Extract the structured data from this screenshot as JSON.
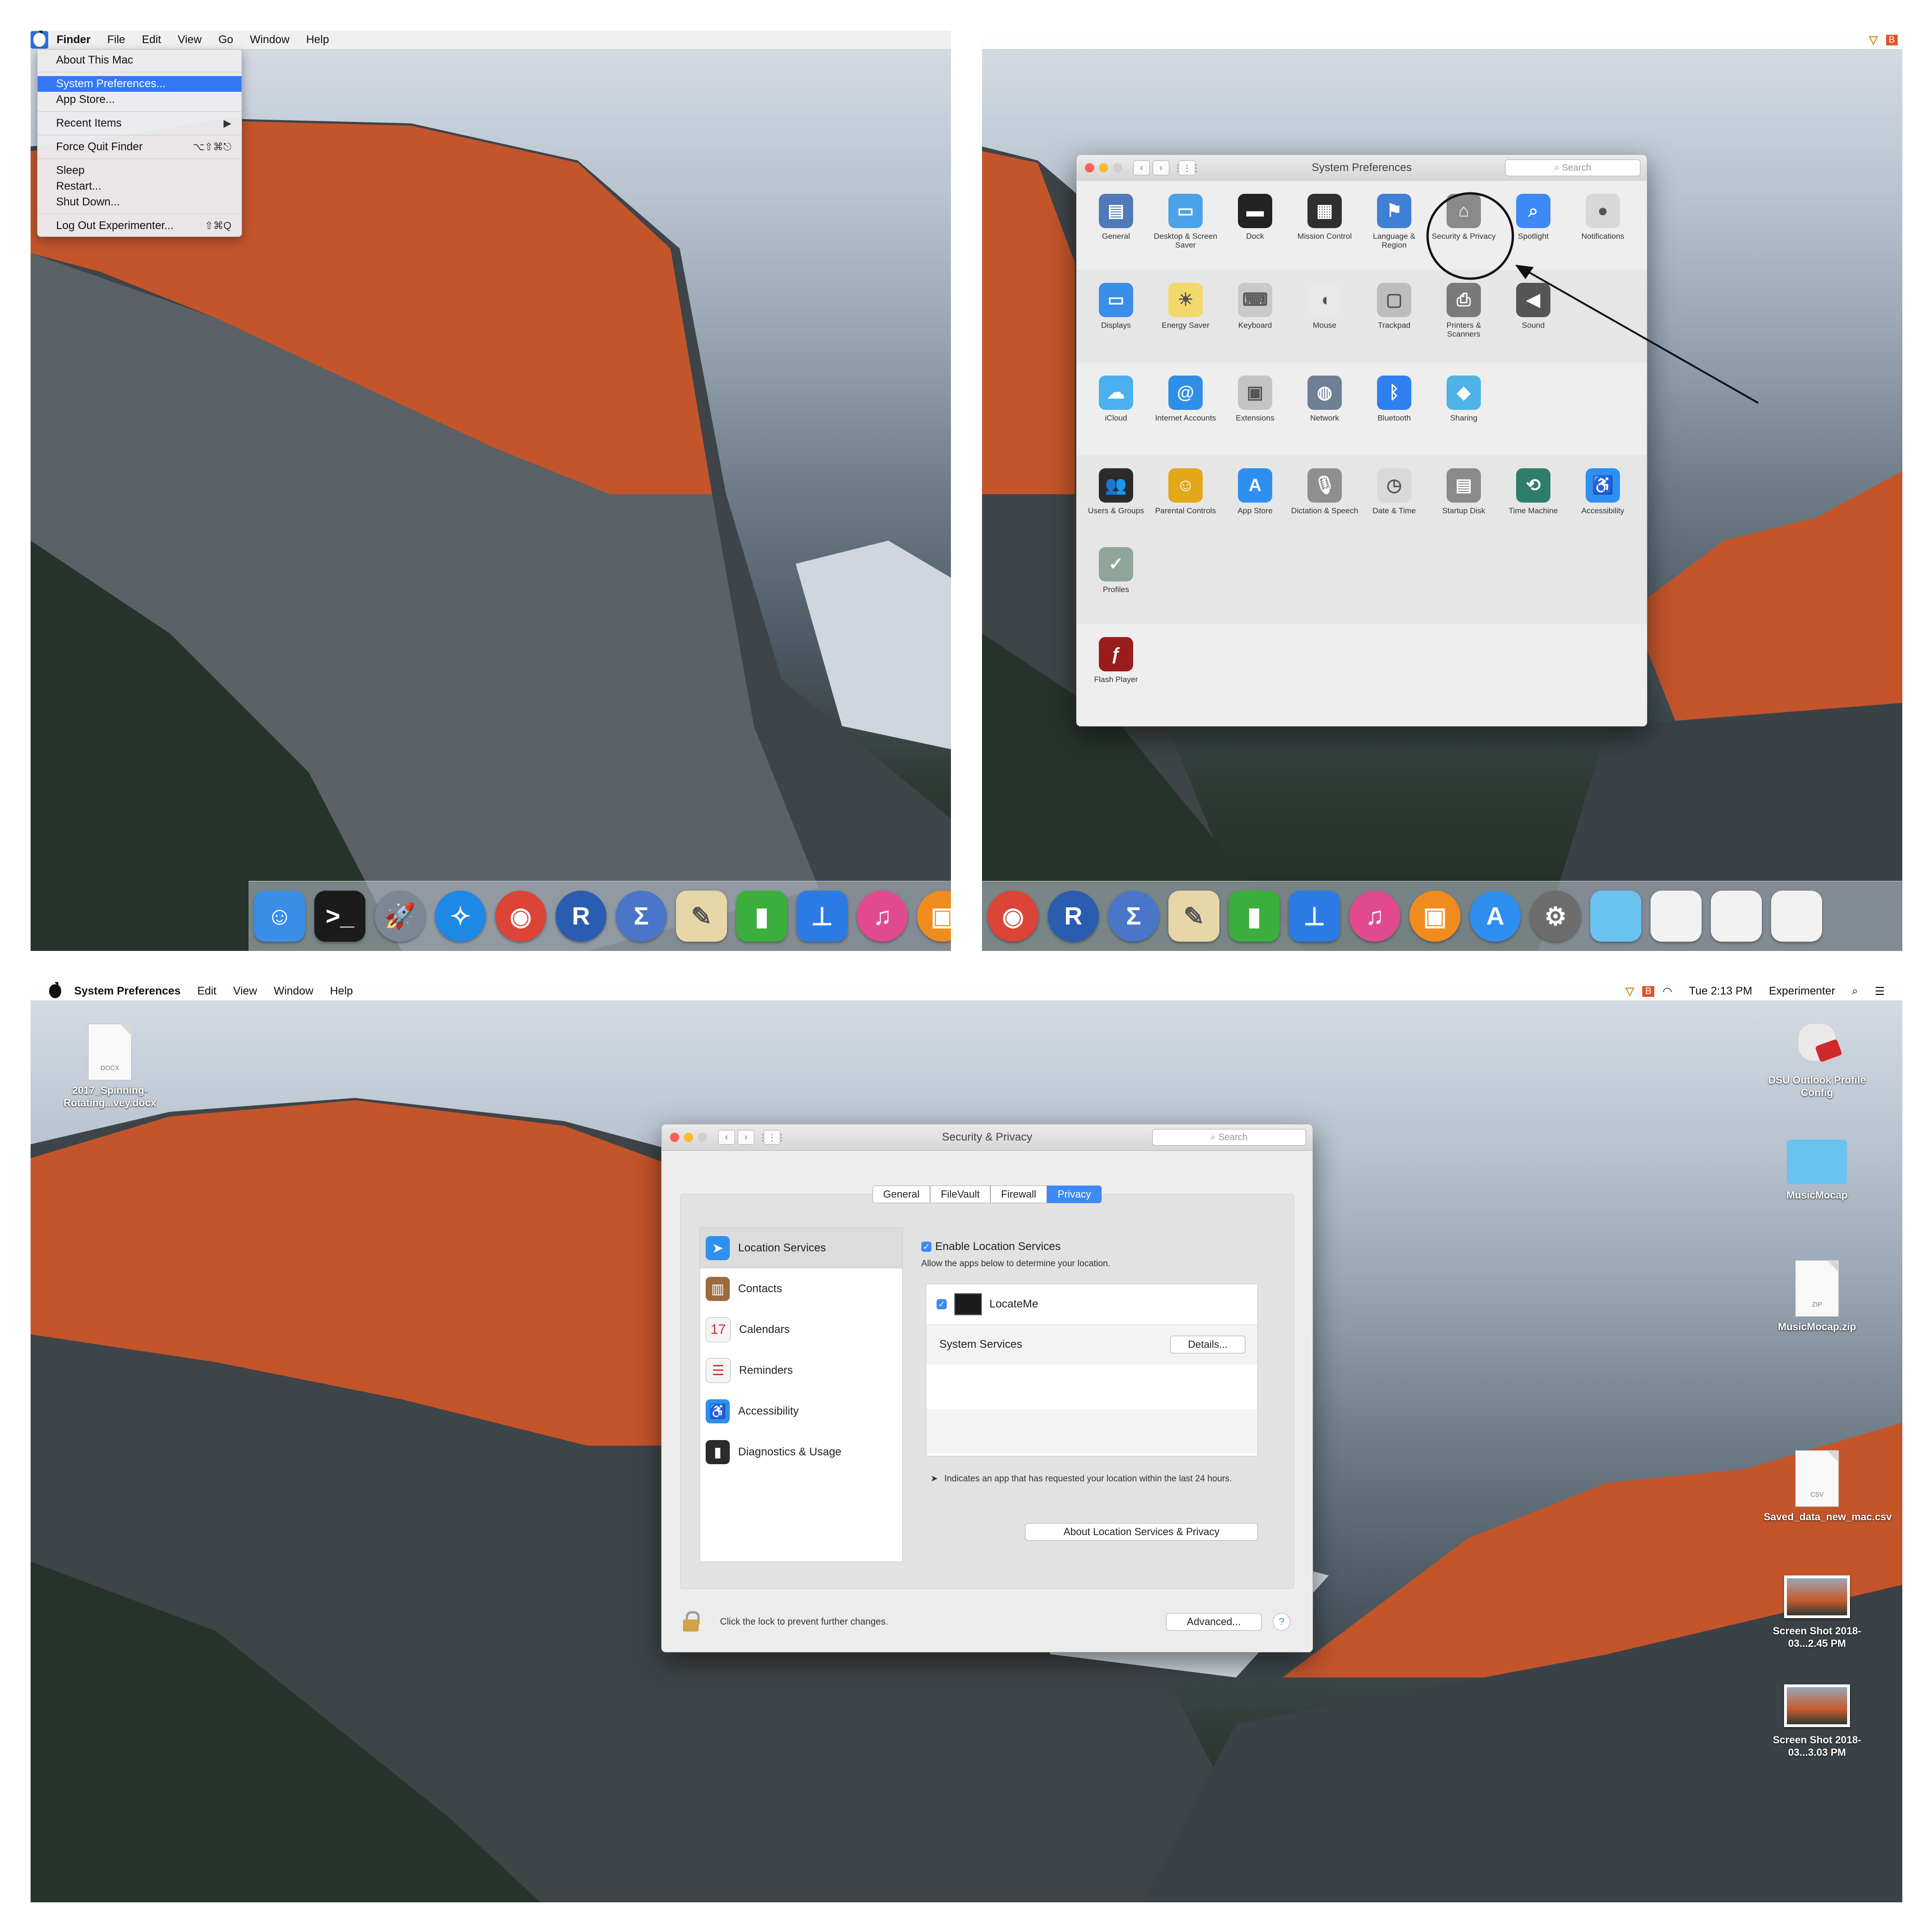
{
  "panel1": {
    "menubar": [
      "Finder",
      "File",
      "Edit",
      "View",
      "Go",
      "Window",
      "Help"
    ],
    "apple_menu": [
      {
        "label": "About This Mac",
        "shortcut": ""
      },
      {
        "sep": true
      },
      {
        "label": "System Preferences...",
        "shortcut": "",
        "highlighted": true
      },
      {
        "label": "App Store...",
        "shortcut": ""
      },
      {
        "sep": true
      },
      {
        "label": "Recent Items",
        "shortcut": "▶"
      },
      {
        "sep": true
      },
      {
        "label": "Force Quit Finder",
        "shortcut": "⌥⇧⌘⎋"
      },
      {
        "sep": true
      },
      {
        "label": "Sleep",
        "shortcut": ""
      },
      {
        "label": "Restart...",
        "shortcut": ""
      },
      {
        "label": "Shut Down...",
        "shortcut": ""
      },
      {
        "sep": true
      },
      {
        "label": "Log Out Experimenter...",
        "shortcut": "⇧⌘Q"
      }
    ],
    "dock": [
      {
        "name": "finder",
        "glyph": "☺",
        "color": "#3a8ee8"
      },
      {
        "name": "terminal",
        "glyph": ">_",
        "color": "#1b1b1b"
      },
      {
        "name": "launchpad",
        "glyph": "🚀",
        "color": "#7d8793"
      },
      {
        "name": "safari",
        "glyph": "✧",
        "color": "#1e88e5"
      },
      {
        "name": "chrome",
        "glyph": "◉",
        "color": "#db4437"
      },
      {
        "name": "r",
        "glyph": "R",
        "color": "#2a5db0"
      },
      {
        "name": "sigma",
        "glyph": "Σ",
        "color": "#4a76c9"
      },
      {
        "name": "textedit",
        "glyph": "✎",
        "color": "#e7d7a8"
      },
      {
        "name": "numbers",
        "glyph": "▮",
        "color": "#3cae3c"
      },
      {
        "name": "keynote",
        "glyph": "⊥",
        "color": "#2c7be5"
      },
      {
        "name": "itunes",
        "glyph": "♫",
        "color": "#e14a8f"
      },
      {
        "name": "ibooks",
        "glyph": "▣",
        "color": "#f08c1e"
      }
    ]
  },
  "panel2": {
    "status": [
      "▽",
      "B"
    ],
    "window_title": "System Preferences",
    "search_placeholder": "Search",
    "rows": [
      [
        {
          "label": "General",
          "icon": "general-icon",
          "color": "#4f79b8",
          "glyph": "▤"
        },
        {
          "label": "Desktop & Screen Saver",
          "icon": "desktop-icon",
          "color": "#4aa3e8",
          "glyph": "▭"
        },
        {
          "label": "Dock",
          "icon": "dock-icon",
          "color": "#222222",
          "glyph": "▬"
        },
        {
          "label": "Mission Control",
          "icon": "mission-control-icon",
          "color": "#2f2f2f",
          "glyph": "▦"
        },
        {
          "label": "Language & Region",
          "icon": "flag-icon",
          "color": "#3f7fd6",
          "glyph": "⚑"
        },
        {
          "label": "Security & Privacy",
          "icon": "house-icon",
          "color": "#8a8a8a",
          "glyph": "⌂"
        },
        {
          "label": "Spotlight",
          "icon": "spotlight-icon",
          "color": "#3d8af7",
          "glyph": "⌕"
        },
        {
          "label": "Notifications",
          "icon": "notifications-icon",
          "color": "#d8d8d8",
          "glyph": "●"
        }
      ],
      [
        {
          "label": "Displays",
          "icon": "displays-icon",
          "color": "#3a8ee8",
          "glyph": "▭"
        },
        {
          "label": "Energy Saver",
          "icon": "bulb-icon",
          "color": "#f3d86b",
          "glyph": "☀"
        },
        {
          "label": "Keyboard",
          "icon": "keyboard-icon",
          "color": "#c9c9c9",
          "glyph": "⌨"
        },
        {
          "label": "Mouse",
          "icon": "mouse-icon",
          "color": "#e8e8e8",
          "glyph": "◖"
        },
        {
          "label": "Trackpad",
          "icon": "trackpad-icon",
          "color": "#bdbdbd",
          "glyph": "▢"
        },
        {
          "label": "Printers & Scanners",
          "icon": "printer-icon",
          "color": "#7a7a7a",
          "glyph": "⎙"
        },
        {
          "label": "Sound",
          "icon": "sound-icon",
          "color": "#555555",
          "glyph": "◀"
        }
      ],
      [
        {
          "label": "iCloud",
          "icon": "icloud-icon",
          "color": "#4ab0ef",
          "glyph": "☁"
        },
        {
          "label": "Internet Accounts",
          "icon": "at-icon",
          "color": "#2f8fe6",
          "glyph": "@"
        },
        {
          "label": "Extensions",
          "icon": "extensions-icon",
          "color": "#c4c4c4",
          "glyph": "▣"
        },
        {
          "label": "Network",
          "icon": "network-icon",
          "color": "#6f7f95",
          "glyph": "◍"
        },
        {
          "label": "Bluetooth",
          "icon": "bluetooth-icon",
          "color": "#2f7ff0",
          "glyph": "ᛒ"
        },
        {
          "label": "Sharing",
          "icon": "sharing-icon",
          "color": "#4fb3e8",
          "glyph": "◆"
        }
      ],
      [
        {
          "label": "Users & Groups",
          "icon": "users-icon",
          "color": "#2b2b2b",
          "glyph": "👥"
        },
        {
          "label": "Parental Controls",
          "icon": "parental-icon",
          "color": "#e3a81a",
          "glyph": "☺"
        },
        {
          "label": "App Store",
          "icon": "appstore-icon",
          "color": "#2f8ff0",
          "glyph": "A"
        },
        {
          "label": "Dictation & Speech",
          "icon": "mic-icon",
          "color": "#8f8f8f",
          "glyph": "🎙"
        },
        {
          "label": "Date & Time",
          "icon": "clock-icon",
          "color": "#d9d9d9",
          "glyph": "◷"
        },
        {
          "label": "Startup Disk",
          "icon": "disk-icon",
          "color": "#8a8a8a",
          "glyph": "▤"
        },
        {
          "label": "Time Machine",
          "icon": "timemachine-icon",
          "color": "#2f7d6b",
          "glyph": "⟲"
        },
        {
          "label": "Accessibility",
          "icon": "accessibility-icon",
          "color": "#2f8ff0",
          "glyph": "♿"
        },
        {
          "label": "Profiles",
          "icon": "profiles-icon",
          "color": "#8fa59a",
          "glyph": "✓"
        }
      ],
      [
        {
          "label": "Flash Player",
          "icon": "flash-icon",
          "color": "#9a1d1d",
          "glyph": "ƒ"
        }
      ]
    ],
    "dock": [
      {
        "name": "chrome",
        "glyph": "◉",
        "color": "#db4437"
      },
      {
        "name": "r",
        "glyph": "R",
        "color": "#2a5db0"
      },
      {
        "name": "sigma",
        "glyph": "Σ",
        "color": "#4a76c9"
      },
      {
        "name": "textedit",
        "glyph": "✎",
        "color": "#e7d7a8"
      },
      {
        "name": "numbers",
        "glyph": "▮",
        "color": "#3cae3c"
      },
      {
        "name": "keynote",
        "glyph": "⊥",
        "color": "#2c7be5"
      },
      {
        "name": "itunes",
        "glyph": "♫",
        "color": "#e14a8f"
      },
      {
        "name": "ibooks",
        "glyph": "▣",
        "color": "#f08c1e"
      },
      {
        "name": "appstore",
        "glyph": "A",
        "color": "#2f8ff0"
      },
      {
        "name": "system-preferences",
        "glyph": "⚙",
        "color": "#6d6d6d"
      },
      {
        "name": "folder",
        "glyph": "",
        "color": "#69c2f0"
      },
      {
        "name": "document",
        "glyph": "",
        "color": "#f2f2f2"
      },
      {
        "name": "document-2",
        "glyph": "",
        "color": "#f2f2f2"
      },
      {
        "name": "document-3",
        "glyph": "",
        "color": "#f2f2f2"
      }
    ]
  },
  "panel3": {
    "menubar": [
      "System Preferences",
      "Edit",
      "View",
      "Window",
      "Help"
    ],
    "status": {
      "time": "Tue 2:13 PM",
      "user": "Experimenter",
      "battery": "▽",
      "b": "B",
      "wifi": "◠"
    },
    "window_title": "Security & Privacy",
    "search_placeholder": "Search",
    "tabs": [
      "General",
      "FileVault",
      "Firewall",
      "Privacy"
    ],
    "active_tab": "Privacy",
    "sidebar": [
      {
        "label": "Location Services",
        "color": "#2f8ff0",
        "glyph": "➤",
        "active": true
      },
      {
        "label": "Contacts",
        "color": "#9b6b3f",
        "glyph": "▥"
      },
      {
        "label": "Calendars",
        "color": "#f4f4f4",
        "glyph": "17"
      },
      {
        "label": "Reminders",
        "color": "#f4f4f4",
        "glyph": "☰"
      },
      {
        "label": "Accessibility",
        "color": "#2f8ff0",
        "glyph": "♿"
      },
      {
        "label": "Diagnostics & Usage",
        "color": "#2b2b2b",
        "glyph": "▮"
      }
    ],
    "enable_location": "Enable Location Services",
    "allow_text": "Allow the apps below to determine your location.",
    "app_name": "LocateMe",
    "system_services": "System Services",
    "details_btn": "Details...",
    "footnote": "Indicates an app that has requested your location within the last 24 hours.",
    "about_btn": "About Location Services & Privacy",
    "lock_text": "Click the lock to prevent further changes.",
    "advanced_btn": "Advanced...",
    "help_btn": "?",
    "desktop": {
      "docx_name": "2017_Spinning-Rotating...vey.docx",
      "docx_ext": "DOCX",
      "outlook_name": "DSU Outlook Profile Config",
      "folder_name": "MusicMocap",
      "zip_name": "MusicMocap.zip",
      "zip_ext": "ZIP",
      "csv_name": "Saved_data_new_mac.csv",
      "csv_ext": "CSV",
      "shot1_name": "Screen Shot 2018-03...2.45 PM",
      "shot2_name": "Screen Shot 2018-03...3.03 PM"
    }
  }
}
